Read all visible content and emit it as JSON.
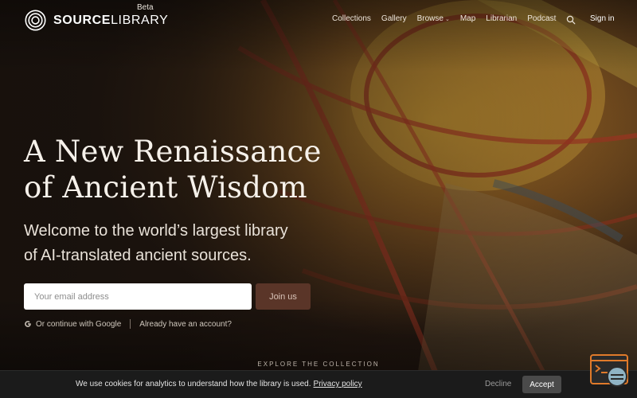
{
  "brand": {
    "name_bold": "SOURCE",
    "name_light": "LIBRARY",
    "badge": "Beta"
  },
  "nav": {
    "items": [
      "Collections",
      "Gallery",
      "Browse",
      "Map",
      "Librarian",
      "Podcast"
    ],
    "search_icon": "search-icon",
    "sign_in": "Sign in"
  },
  "hero": {
    "headline_line1": "A New Renaissance",
    "headline_line2": "of Ancient Wisdom",
    "subline_line1": "Welcome to the world’s largest library",
    "subline_line2": "of AI-translated ancient sources.",
    "email_placeholder": "Your email address",
    "join_label": "Join us",
    "google_label": "Or continue with Google",
    "have_account": "Already have an account?",
    "explore_label": "EXPLORE THE COLLECTION"
  },
  "cookie": {
    "message": "We use cookies for analytics to understand how the library is used.",
    "privacy_link": "Privacy policy",
    "decline": "Decline",
    "accept": "Accept"
  },
  "colors": {
    "accent_button": "#5a3528",
    "cookie_bg": "#1b1b1b",
    "hero_base": "#1e1611"
  }
}
